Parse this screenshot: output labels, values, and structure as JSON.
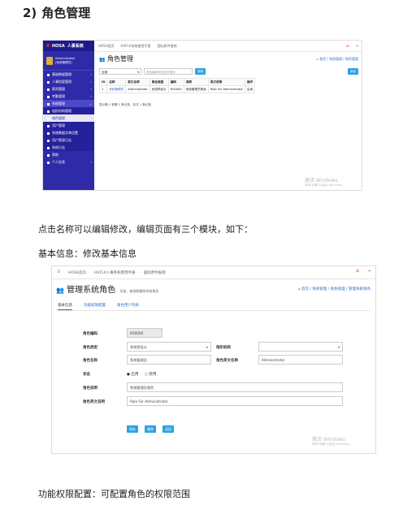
{
  "heading": {
    "num": "2)",
    "text": "角色管理"
  },
  "para1": "点击名称可以编辑修改，编辑页面有三个模块，如下：",
  "para2": "基本信息：修改基本信息",
  "para3": "功能权限配置：可配置角色的权限范围",
  "shot1": {
    "logo_x": "X",
    "logo_brand": "HOSA",
    "logo_system": "人事系统",
    "user_line1": "Administrator",
    "user_line2": "(系统管理员)",
    "menu": [
      {
        "label": "基础数据管理",
        "chev": "›",
        "cls": ""
      },
      {
        "label": "人事档案管理",
        "chev": "›",
        "cls": ""
      },
      {
        "label": "薪资管理",
        "chev": "›",
        "cls": ""
      },
      {
        "label": "考勤管理",
        "chev": "›",
        "cls": ""
      },
      {
        "label": "系统管理",
        "chev": "⌄",
        "cls": "act"
      },
      {
        "label": "组织机构管理",
        "chev": "",
        "cls": "sub"
      },
      {
        "label": "角色管理",
        "chev": "",
        "cls": "selsub"
      },
      {
        "label": "用户管理",
        "chev": "",
        "cls": "sub"
      },
      {
        "label": "系统数据字典设置",
        "chev": "",
        "cls": "sub"
      },
      {
        "label": "用户登录日志",
        "chev": "",
        "cls": "sub"
      },
      {
        "label": "系统日志",
        "chev": "",
        "cls": "sub"
      },
      {
        "label": "帮助",
        "chev": "",
        "cls": ""
      },
      {
        "label": "个人信息",
        "chev": "›",
        "cls": ""
      }
    ],
    "top_links": [
      "HOSA首页",
      "HVFLX系统使用手册",
      "国际原件报销"
    ],
    "top_icons": [
      "☒",
      "⇥"
    ],
    "title_icon": "👥",
    "title": "角色管理",
    "breadcrumb": "⌂ 首页 / 系统管理 / 角色管理",
    "select_value": "全部",
    "search_placeholder": "角色编码或名称关键字",
    "search_button": "搜索",
    "add_button": "添加",
    "columns": [
      "ID",
      "名称",
      "英文名称",
      "角色类型",
      "编码",
      "说明",
      "英文说明",
      "操作"
    ],
    "rows": [
      [
        "1",
        "系统管理员",
        "Administrator",
        "系统预设义",
        "R00000",
        "系统管理员角色",
        "Role For Administrator",
        "启用"
      ]
    ],
    "pagination": "显示第 1 到第 1 条记录，总共 1 条记录",
    "watermark_main": "激活 Windows",
    "watermark_sub": "转到\"设置\"以激活 Windows。"
  },
  "shot2": {
    "top_links": [
      "HOSA首页",
      "HVFLX人事系统使用手册",
      "国际原件报销"
    ],
    "top_icons": [
      "☒",
      "⇥"
    ],
    "title_icon": "👥",
    "title": "管理系统角色",
    "subtitle": "添加、修改和删除系统角色",
    "breadcrumb": "⌂ 首页 / 系统管理 / 角色管理 / 管理系统角色",
    "tabs": [
      "基本信息",
      "功能权限配置",
      "角色用户列表"
    ],
    "labels": {
      "code": "角色编码",
      "type": "角色类型",
      "org": "组织机构",
      "name": "角色名称",
      "en_name": "角色英文名称",
      "status": "状态",
      "desc": "角色说明",
      "en_desc": "角色英文说明"
    },
    "values": {
      "code": "R00000",
      "type": "系统预设义",
      "org": "",
      "name": "系统管理员",
      "en_name": "Administrator",
      "desc": "系统管理员角色",
      "en_desc": "Role For Administrator"
    },
    "status_options": [
      "● 启用",
      "○ 禁用"
    ],
    "buttons": [
      "保存",
      "删除",
      "返回"
    ],
    "button_colors": [
      "#2aa2e0",
      "#2aa2e0",
      "#2aa2e0"
    ],
    "watermark_main": "激活 Windows",
    "watermark_sub": "转到\"设置\"以激活 Windows。"
  }
}
